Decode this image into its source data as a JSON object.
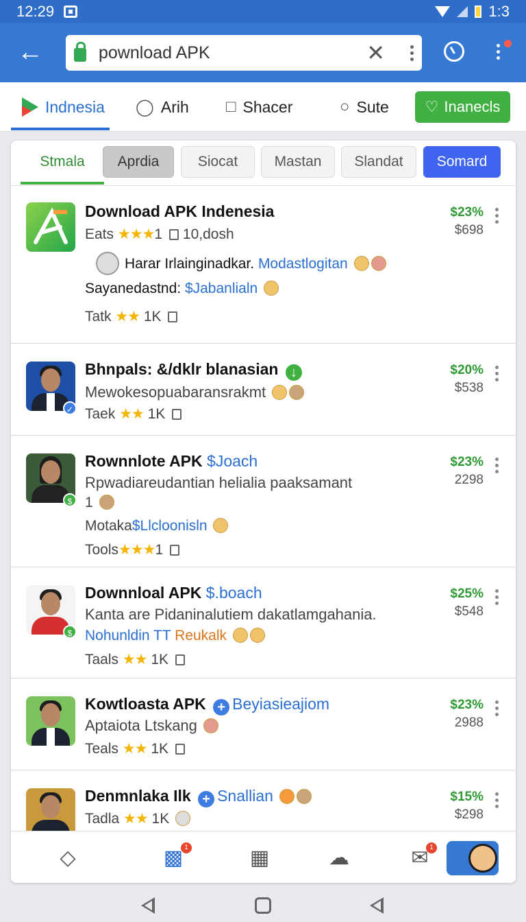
{
  "status_bar": {
    "time": "12:29",
    "battery_text": "1:3"
  },
  "header": {
    "url": "pownload APK"
  },
  "categories": [
    {
      "label": "Indnesia",
      "icon": "play-store-icon"
    },
    {
      "label": "Arih",
      "icon": "people-icon"
    },
    {
      "label": "Shacer",
      "icon": "chat-icon"
    },
    {
      "label": "Sute",
      "icon": "tag-icon"
    }
  ],
  "interest_button": {
    "label": "Inanecls",
    "icon": "heart-icon"
  },
  "filters": [
    "Stmala",
    "Aprdia",
    "Siocat",
    "Mastan",
    "Slandat",
    "Somard"
  ],
  "items": [
    {
      "title": "Download APK Indenesia",
      "meta_label": "Eats",
      "stars": "★★★",
      "star_suffix": "1",
      "downloads": "10,dosh",
      "user_name": "Harar Irlainginadkar.",
      "user_link": "Modastlogitan",
      "line3_label": "Sayanedastnd:",
      "line3_link": "$Jabanlialn",
      "rating_label": "Tatk",
      "rating_stars": "★★",
      "rating_value": "1K",
      "price_change": "$23%",
      "price": "$698"
    },
    {
      "title": "Bhnpals: &/dklr blanasian",
      "subtitle": "Mewokesopuabaransrakmt",
      "rating_label": "Taek",
      "rating_stars": "★★",
      "rating_value": "1K",
      "price_change": "$20%",
      "price": "$538"
    },
    {
      "title": "Rownnlote APK",
      "title_link": "$Joach",
      "subtitle": "Rpwadiareudantian helialia paaksamant",
      "count": "1",
      "line3_label": "Motaka",
      "line3_link": "$Llcloonisln",
      "rating_label": "Tools",
      "rating_stars": "★★★",
      "rating_value": "1",
      "price_change": "$23%",
      "price": "2298"
    },
    {
      "title": "Downnloal APK",
      "title_link": "$.boach",
      "subtitle": "Kanta are Pidaninalutiem dakatlamgahania.",
      "line3_link": "Nohunldin TT",
      "line3_orange": "Reukalk",
      "rating_label": "Taals",
      "rating_stars": "★★",
      "rating_value": "1K",
      "price_change": "$25%",
      "price": "$548"
    },
    {
      "title": "Kowtloasta APK",
      "title_link": "Beyiasieajiom",
      "subtitle": "Aptaiota Ltskang",
      "rating_label": "Teals",
      "rating_stars": "★★",
      "rating_value": "1K",
      "price_change": "$23%",
      "price": "2988"
    },
    {
      "title": "Denmnlaka Ilk",
      "title_link": "Snallian",
      "rating_label": "Tadla",
      "rating_stars": "★★",
      "rating_value": "1K",
      "price_change": "$15%",
      "price": "$298"
    }
  ],
  "bottom_nav": {
    "chat_badge": "1",
    "mail_badge": "1"
  },
  "colors": {
    "primary": "#3579d3",
    "green": "#3fb041",
    "blue_chip": "#3f64f0",
    "price_up": "#2f9a34"
  }
}
